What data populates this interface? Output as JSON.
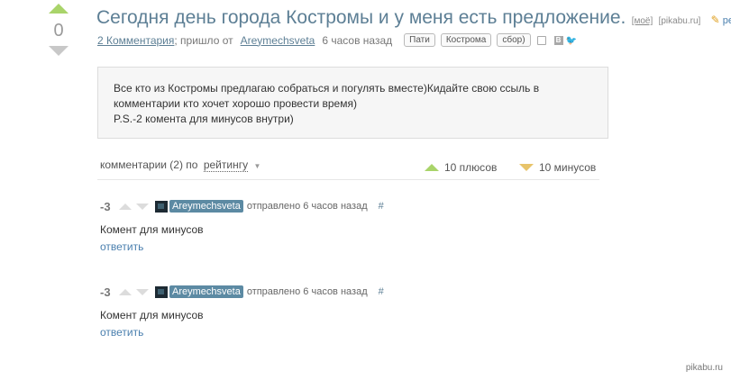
{
  "vote": {
    "rating": "0"
  },
  "post": {
    "title": "Сегодня день города Костромы и у меня есть предложение.",
    "mine_label": "[моё]",
    "source_label": "[pikabu.ru]",
    "edit_label": "ред.",
    "comments_link": "2 Комментария",
    "came_from": "; пришло от",
    "author": "Areymechsveta",
    "time_ago": "6 часов назад",
    "tags": [
      "Пати",
      "Кострома",
      "сбор)"
    ],
    "body_lines": [
      "Все кто из Костромы предлагаю собраться и погулять вместе)Кидайте свою ссыль в",
      "комментарии кто хочет хорошо провести время)",
      "P.S.-2 комента для минусов внутри)"
    ]
  },
  "comments_header": {
    "count_label": "комментарии (2) по",
    "sort_label": "рейтингу",
    "pluses_label": "10 плюсов",
    "minuses_label": "10 минусов"
  },
  "comments": [
    {
      "rating": "-3",
      "user": "Areymechsveta",
      "meta": "отправлено 6 часов назад",
      "hash": "#",
      "text": "Комент для минусов",
      "reply": "ответить"
    },
    {
      "rating": "-3",
      "user": "Areymechsveta",
      "meta": "отправлено 6 часов назад",
      "hash": "#",
      "text": "Комент для минусов",
      "reply": "ответить"
    }
  ],
  "watermark": "pikabu.ru"
}
